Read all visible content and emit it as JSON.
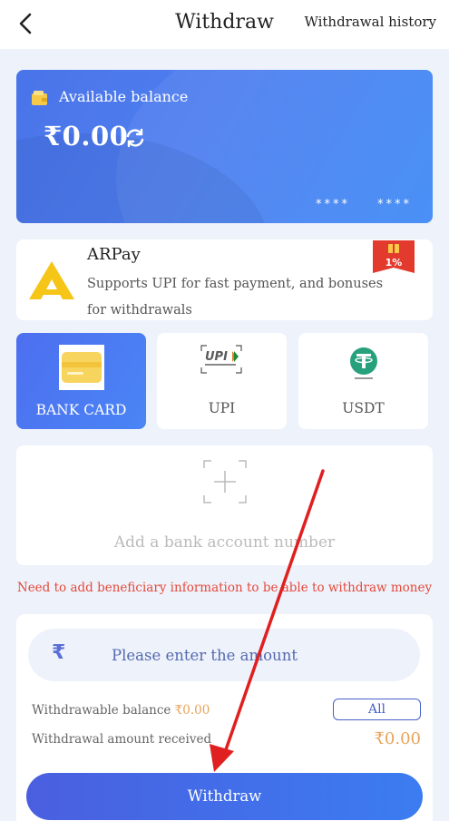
{
  "header": {
    "title": "Withdraw",
    "history_link": "Withdrawal history"
  },
  "balance_card": {
    "label": "Available balance",
    "amount": "₹0.00",
    "masked_1": "****",
    "masked_2": "****"
  },
  "arpay": {
    "name": "ARPay",
    "description": "Supports UPI for fast payment, and bonuses for withdrawals",
    "badge": "1%"
  },
  "methods": [
    {
      "label": "BANK CARD",
      "active": true
    },
    {
      "label": "UPI",
      "active": false
    },
    {
      "label": "USDT",
      "active": false
    }
  ],
  "add_account": {
    "label": "Add a bank account number"
  },
  "warning": "Need to add beneficiary information to be able to withdraw money",
  "amount_form": {
    "currency_symbol": "₹",
    "placeholder": "Please enter the amount",
    "withdrawable_label": "Withdrawable balance ",
    "withdrawable_value": "₹0.00",
    "all_button": "All",
    "received_label": "Withdrawal amount received",
    "received_value": "₹0.00"
  },
  "withdraw_button": "Withdraw",
  "colors": {
    "accent": "#4a74e9",
    "warning": "#e5493a",
    "highlight": "#e8a35a",
    "annotation_arrow": "#e02020"
  }
}
